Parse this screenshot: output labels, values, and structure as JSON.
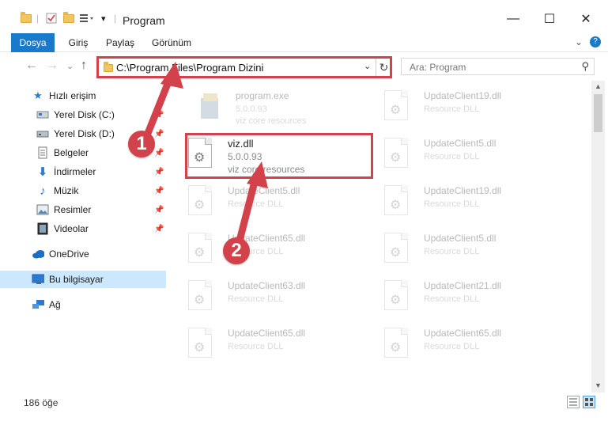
{
  "window": {
    "title": "Program",
    "minimize_glyph": "—",
    "maximize_glyph": "☐",
    "close_glyph": "✕"
  },
  "ribbon": {
    "tabs": [
      "Dosya",
      "Giriş",
      "Paylaş",
      "Görünüm"
    ],
    "expand_glyph": "⌄",
    "help_glyph": "?"
  },
  "address": {
    "path": "C:\\Program Files\\Program Dizini",
    "dropdown_glyph": "⌄",
    "refresh_glyph": "↻"
  },
  "nav": {
    "back_glyph": "←",
    "forward_glyph": "→",
    "history_glyph": "⌄",
    "up_glyph": "↑"
  },
  "search": {
    "placeholder": "Ara: Program",
    "icon": "search-icon"
  },
  "sidebar": {
    "items": [
      {
        "label": "Hızlı erişim",
        "icon": "star-icon",
        "pinned": false
      },
      {
        "label": "Yerel Disk (C:)",
        "icon": "drive-icon",
        "pinned": true
      },
      {
        "label": "Yerel Disk (D:)",
        "icon": "drive-icon",
        "pinned": true
      },
      {
        "label": "Belgeler",
        "icon": "documents-icon",
        "pinned": true
      },
      {
        "label": "İndirmeler",
        "icon": "download-icon",
        "pinned": true
      },
      {
        "label": "Müzik",
        "icon": "music-icon",
        "pinned": true
      },
      {
        "label": "Resimler",
        "icon": "pictures-icon",
        "pinned": true
      },
      {
        "label": "Videolar",
        "icon": "videos-icon",
        "pinned": true
      },
      {
        "label": "OneDrive",
        "icon": "cloud-icon",
        "pinned": false
      },
      {
        "label": "Bu bilgisayar",
        "icon": "computer-icon",
        "pinned": false
      },
      {
        "label": "Ağ",
        "icon": "network-icon",
        "pinned": false
      }
    ]
  },
  "files": {
    "program_exe": {
      "name": "program.exe",
      "version": "5.0.0.93",
      "desc": "viz core resources"
    },
    "viz_dll": {
      "name": "viz.dll",
      "version": "5.0.0.93",
      "desc": "viz core resources"
    },
    "left_col": [
      {
        "name": "UpdateClient5.dll",
        "desc": "Resource DLL"
      },
      {
        "name": "UpdateClient65.dll",
        "desc": "Resource DLL"
      },
      {
        "name": "UpdateClient63.dll",
        "desc": "Resource DLL"
      },
      {
        "name": "UpdateClient65.dll",
        "desc": "Resource DLL"
      }
    ],
    "right_col": [
      {
        "name": "UpdateClient19.dll",
        "desc": "Resource DLL"
      },
      {
        "name": "UpdateClient5.dll",
        "desc": "Resource DLL"
      },
      {
        "name": "UpdateClient19.dll",
        "desc": "Resource DLL"
      },
      {
        "name": "UpdateClient5.dll",
        "desc": "Resource DLL"
      },
      {
        "name": "UpdateClient21.dll",
        "desc": "Resource DLL"
      },
      {
        "name": "UpdateClient65.dll",
        "desc": "Resource DLL"
      }
    ]
  },
  "status": {
    "count": "186 öğe"
  },
  "callouts": {
    "one": "1",
    "two": "2"
  },
  "colors": {
    "accent": "#1979ca",
    "highlight": "#d3414b",
    "selection": "#cce8ff"
  }
}
